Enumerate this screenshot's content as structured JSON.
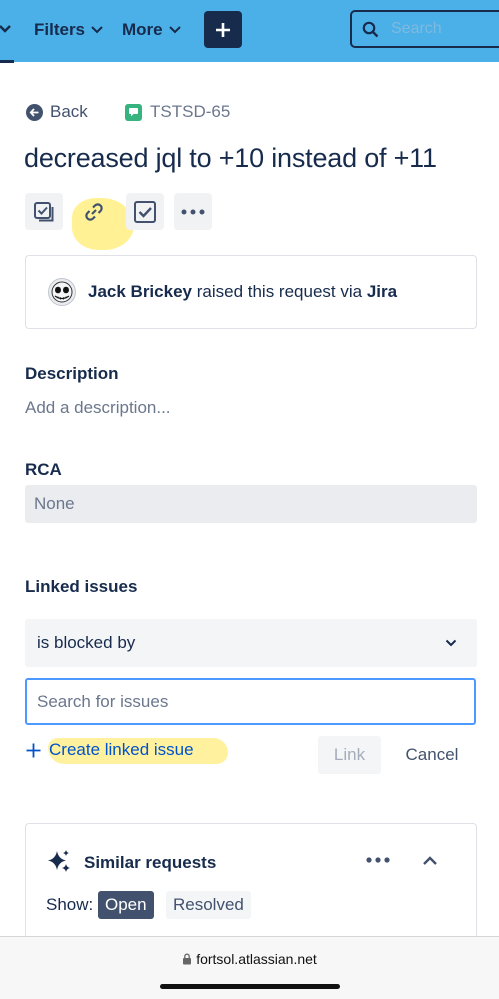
{
  "nav": {
    "filters_label": "Filters",
    "more_label": "More",
    "search_placeholder": "Search"
  },
  "breadcrumb": {
    "back_label": "Back",
    "issue_key": "TSTSD-65"
  },
  "issue": {
    "title": "decreased jql to +10 instead of +11"
  },
  "actions": [
    "checklist-icon",
    "link-icon",
    "checkbox-icon",
    "more-icon"
  ],
  "raised": {
    "reporter": "Jack Brickey",
    "middle_text": "raised this request via",
    "channel": "Jira"
  },
  "description": {
    "label": "Description",
    "placeholder": "Add a description..."
  },
  "rca": {
    "label": "RCA",
    "value": "None"
  },
  "linked_issues": {
    "label": "Linked issues",
    "link_type": "is blocked by",
    "search_placeholder": "Search for issues",
    "create_label": "Create linked issue",
    "link_button": "Link",
    "cancel_button": "Cancel"
  },
  "similar_requests": {
    "heading": "Similar requests",
    "show_label": "Show:",
    "filters": [
      "Open",
      "Resolved"
    ],
    "selected_filter": "Open"
  },
  "browser": {
    "url": "fortsol.atlassian.net"
  },
  "colors": {
    "nav_background": "#4bb0e8",
    "primary_text": "#172b4d",
    "link_blue": "#0052cc",
    "focus_border": "#4c9aff",
    "highlight": "#ffdd00"
  }
}
